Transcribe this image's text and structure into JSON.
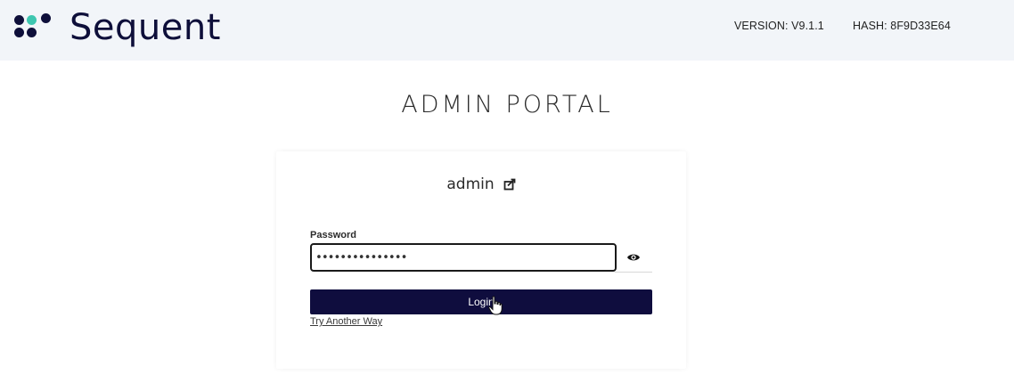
{
  "header": {
    "brand": "Sequent",
    "version": "VERSION: V9.1.1",
    "hash": "HASH: 8F9D33E64",
    "logo_colors": [
      "#0e0f3a",
      "#3ec6b0",
      "#0e0f3a",
      "#0e0f3a",
      "#0e0f3a"
    ]
  },
  "page": {
    "title": "ADMIN PORTAL"
  },
  "login": {
    "username": "admin",
    "edit_icon": "edit-user-icon",
    "password_label": "Password",
    "password_value": "•••••••••••••••",
    "eye_icon": "eye-icon",
    "login_label": "Login",
    "try_another_label": "Try Another Way"
  },
  "colors": {
    "primary": "#0f0d3e",
    "header_bg": "#f2f5f9",
    "accent": "#3ec6b0"
  }
}
